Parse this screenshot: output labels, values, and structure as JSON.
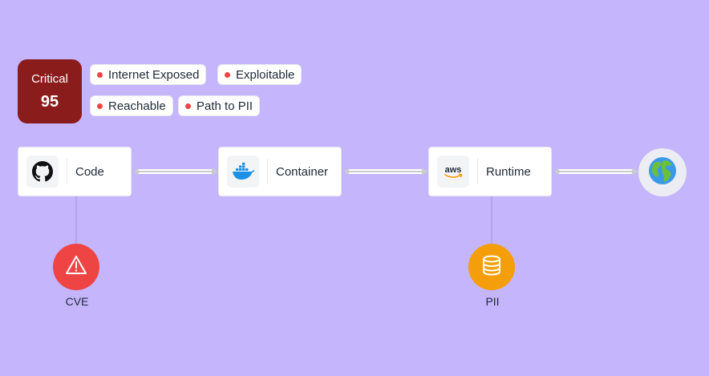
{
  "severity": {
    "label": "Critical",
    "score": "95",
    "color": "#8b1c1c"
  },
  "tags": [
    {
      "label": "Internet Exposed",
      "dot_color": "#ef4444"
    },
    {
      "label": "Exploitable",
      "dot_color": "#ef4444"
    },
    {
      "label": "Reachable",
      "dot_color": "#ef4444"
    },
    {
      "label": "Path to PII",
      "dot_color": "#ef4444"
    }
  ],
  "nodes": [
    {
      "label": "Code",
      "icon": "github-icon"
    },
    {
      "label": "Container",
      "icon": "docker-icon"
    },
    {
      "label": "Runtime",
      "icon": "aws-icon"
    }
  ],
  "destination": {
    "icon": "globe-icon"
  },
  "issues": [
    {
      "label": "CVE",
      "icon": "warning-icon",
      "color": "#ef4444"
    },
    {
      "label": "PII",
      "icon": "database-icon",
      "color": "#f59e0b"
    }
  ],
  "colors": {
    "background": "#c4b5fd",
    "connector": "#c9cbd1"
  }
}
